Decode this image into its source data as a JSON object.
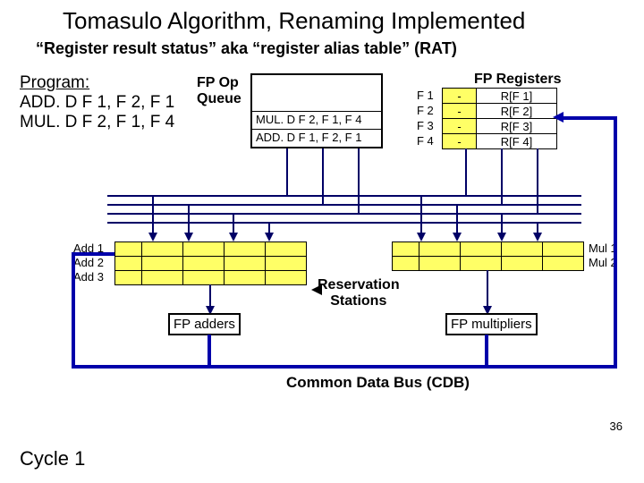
{
  "title": "Tomasulo Algorithm, Renaming Implemented",
  "subtitle": "“Register result status” aka “register alias table” (RAT)",
  "program": {
    "header": "Program:",
    "lines": [
      "ADD. D  F 1, F 2, F 1",
      "MUL. D  F 2, F 1, F 4"
    ]
  },
  "fpop": {
    "label": "FP Op\nQueue",
    "rows": [
      "MUL. D F 2, F 1, F 4",
      "ADD. D F 1, F 2, F 1"
    ]
  },
  "fpreg": {
    "label": "FP Registers",
    "rows": [
      {
        "name": "F 1",
        "tag": "-",
        "val": "R[F 1]"
      },
      {
        "name": "F 2",
        "tag": "-",
        "val": "R[F 2]"
      },
      {
        "name": "F 3",
        "tag": "-",
        "val": "R[F 3]"
      },
      {
        "name": "F 4",
        "tag": "-",
        "val": "R[F 4]"
      }
    ]
  },
  "add_rs": {
    "labels": [
      "Add 1",
      "Add 2",
      "Add 3"
    ]
  },
  "mul_rs": {
    "labels": [
      "Mul 1",
      "Mul 2"
    ]
  },
  "rs_label": "Reservation\nStations",
  "fpadders": "FP adders",
  "fpmults": "FP multipliers",
  "cdb": "Common Data Bus (CDB)",
  "cycle": "Cycle 1",
  "page": "36"
}
